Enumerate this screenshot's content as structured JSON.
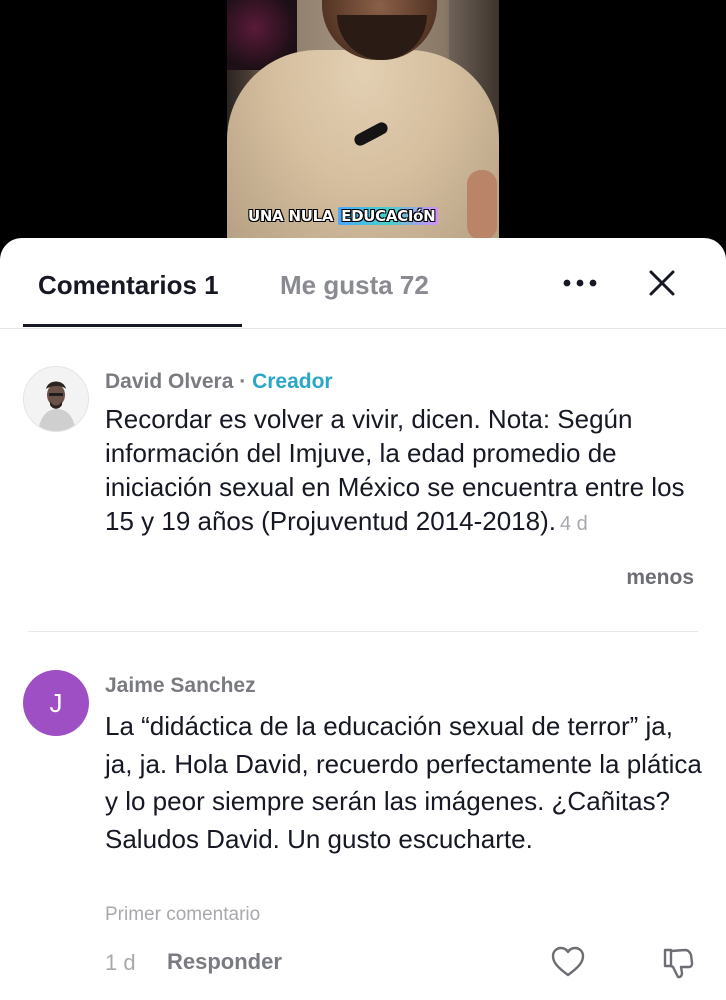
{
  "video": {
    "caption_words": [
      "UNA",
      "NULA",
      "EDUCACIóN"
    ]
  },
  "tabs": {
    "comments_label": "Comentarios 1",
    "likes_label": "Me gusta 72"
  },
  "icons": {
    "more": "more-horizontal-icon",
    "close": "close-icon",
    "heart": "heart-icon",
    "dislike": "thumbs-down-icon"
  },
  "comments": [
    {
      "author": "David Olvera",
      "separator": " · ",
      "badge": "Creador",
      "text": "Recordar es volver a vivir, dicen. Nota: Según información del Imjuve, la edad promedio de iniciación sexual en México se encuentra entre los 15 y 19 años (Projuventud 2014-2018).",
      "time": "4 d",
      "less_label": "menos"
    },
    {
      "author": "Jaime Sanchez",
      "avatar_letter": "J",
      "text": "La “didáctica de la educación sexual de terror” ja, ja, ja. Hola David, recuerdo perfectamente la plática y lo peor siempre serán las imágenes. ¿Cañitas? Saludos David. Un gusto escucharte.",
      "tag": "Primer comentario",
      "time": "1 d",
      "reply_label": "Responder"
    }
  ],
  "colors": {
    "creator_badge": "#2aa6c7",
    "avatar_j": "#9f4fc4",
    "text_primary": "#161823",
    "text_secondary": "#8a8b91"
  }
}
